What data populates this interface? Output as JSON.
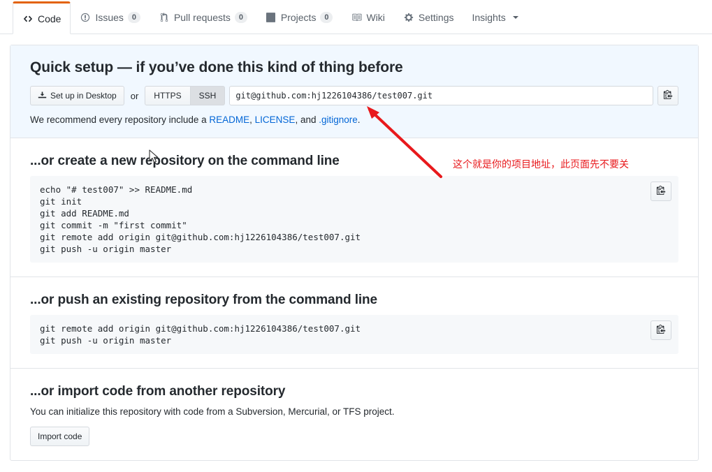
{
  "nav": {
    "tabs": [
      {
        "label": "Code",
        "icon": "code-icon",
        "count": null,
        "selected": true,
        "caret": false
      },
      {
        "label": "Issues",
        "icon": "issue-opened-icon",
        "count": "0",
        "selected": false,
        "caret": false
      },
      {
        "label": "Pull requests",
        "icon": "git-pull-request-icon",
        "count": "0",
        "selected": false,
        "caret": false
      },
      {
        "label": "Projects",
        "icon": "project-icon",
        "count": "0",
        "selected": false,
        "caret": false
      },
      {
        "label": "Wiki",
        "icon": "book-icon",
        "count": null,
        "selected": false,
        "caret": false
      },
      {
        "label": "Settings",
        "icon": "gear-icon",
        "count": null,
        "selected": false,
        "caret": false
      },
      {
        "label": "Insights",
        "icon": null,
        "count": null,
        "selected": false,
        "caret": true
      }
    ]
  },
  "quick_setup": {
    "heading": "Quick setup — if you’ve done this kind of thing before",
    "desktop_button": "Set up in Desktop",
    "or_label": "or",
    "protocol_https": "HTTPS",
    "protocol_ssh": "SSH",
    "active_protocol": "SSH",
    "clone_url": "git@github.com:hj1226104386/test007.git",
    "copy_icon": "clipboard-icon",
    "recommend_prefix": "We recommend every repository include a ",
    "recommend_link_readme": "README",
    "recommend_sep1": ", ",
    "recommend_link_license": "LICENSE",
    "recommend_sep2": ", and ",
    "recommend_link_gitignore": ".gitignore",
    "recommend_suffix": "."
  },
  "create_section": {
    "heading": "...or create a new repository on the command line",
    "code": "echo \"# test007\" >> README.md\ngit init\ngit add README.md\ngit commit -m \"first commit\"\ngit remote add origin git@github.com:hj1226104386/test007.git\ngit push -u origin master",
    "copy_icon": "clipboard-icon"
  },
  "push_section": {
    "heading": "...or push an existing repository from the command line",
    "code": "git remote add origin git@github.com:hj1226104386/test007.git\ngit push -u origin master",
    "copy_icon": "clipboard-icon"
  },
  "import_section": {
    "heading": "...or import code from another repository",
    "description": "You can initialize this repository with code from a Subversion, Mercurial, or TFS project.",
    "button": "Import code"
  },
  "annotation": {
    "text": "这个就是你的项目地址，此页面先不要关",
    "color": "#e8191c",
    "arrow_name": "red-arrow-annotation"
  },
  "colors": {
    "accent_orange": "#e36209",
    "link_blue": "#0366d6",
    "panel_blue_bg": "#f1f8ff",
    "code_bg": "#f6f8fa",
    "border": "#e1e4e8",
    "annotation_red": "#e8191c"
  }
}
